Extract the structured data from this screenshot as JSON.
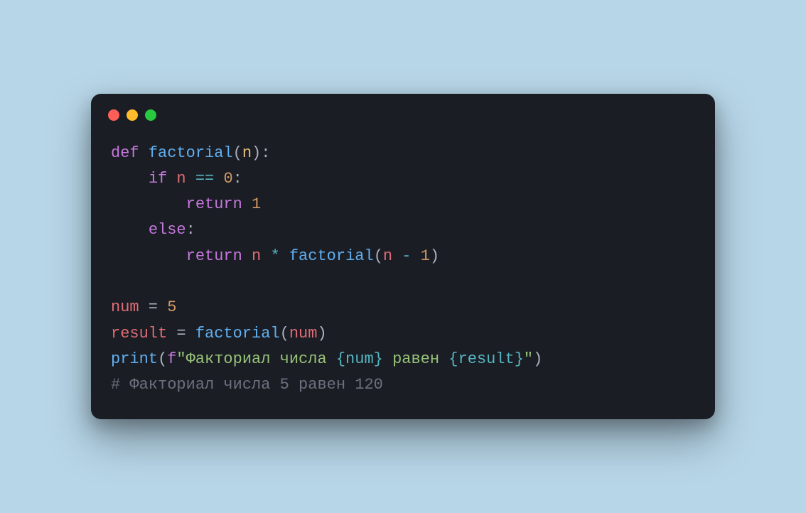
{
  "code": {
    "l1": {
      "def": "def ",
      "fn": "factorial",
      "open": "(",
      "param": "n",
      "close": "):"
    },
    "l2": {
      "indent": "    ",
      "if": "if",
      "sp": " ",
      "var": "n",
      "op": " == ",
      "num": "0",
      "colon": ":"
    },
    "l3": {
      "indent": "        ",
      "ret": "return ",
      "num": "1"
    },
    "l4": {
      "indent": "    ",
      "else": "else",
      "colon": ":"
    },
    "l5": {
      "indent": "        ",
      "ret": "return ",
      "var1": "n",
      "op1": " * ",
      "fn": "factorial",
      "open": "(",
      "var2": "n",
      "op2": " - ",
      "num": "1",
      "close": ")"
    },
    "l6": "",
    "l7": {
      "var": "num",
      "eq": " = ",
      "num": "5"
    },
    "l8": {
      "var": "result",
      "eq": " = ",
      "fn": "factorial",
      "open": "(",
      "arg": "num",
      "close": ")"
    },
    "l9": {
      "fn": "print",
      "open": "(",
      "f": "f",
      "q1": "\"",
      "s1": "Факториал числа ",
      "b1": "{num}",
      "s2": " равен ",
      "b2": "{result}",
      "q2": "\"",
      "close": ")"
    },
    "l10": {
      "cmt": "# Факториал числа 5 равен 120"
    }
  }
}
